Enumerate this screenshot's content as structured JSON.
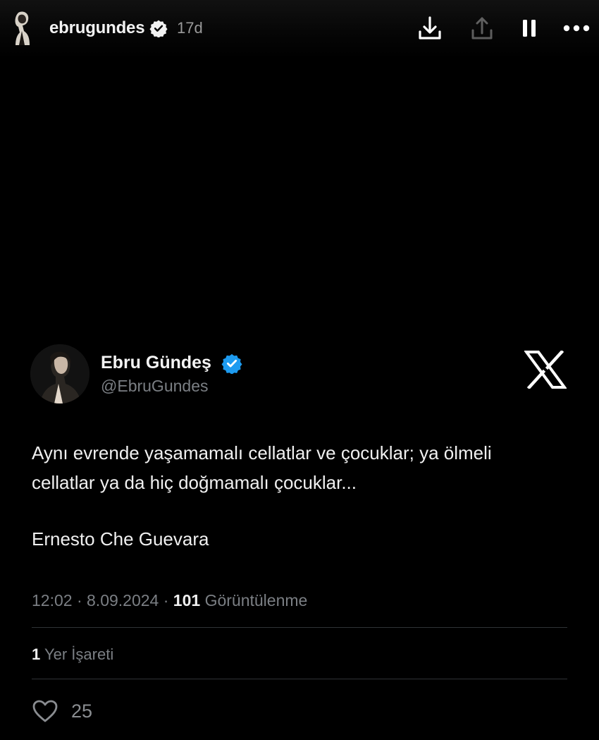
{
  "story": {
    "username": "ebrugundes",
    "age": "17d"
  },
  "tweet": {
    "display_name": "Ebru Gündeş",
    "handle": "@EbruGundes",
    "text": "Aynı evrende yaşamamalı cellatlar ve çocuklar; ya ölmeli cellatlar ya da hiç doğmamalı çocuklar...",
    "author_line": "Ernesto Che Guevara",
    "time": "12:02",
    "date": "8.09.2024",
    "views_count": "101",
    "views_label": "Görüntülenme",
    "bookmarks_count": "1",
    "bookmarks_label": "Yer İşareti",
    "likes_count": "25"
  },
  "icons": {
    "download": "download-icon",
    "share": "share-icon",
    "pause": "pause-icon",
    "more": "more-icon",
    "verified": "verified-badge-icon",
    "x_logo": "x-logo",
    "heart": "heart-icon"
  },
  "colors": {
    "background": "#000000",
    "verified_blue": "#1d9bf0",
    "muted_text": "#7b7f84",
    "divider": "#2f3336"
  }
}
